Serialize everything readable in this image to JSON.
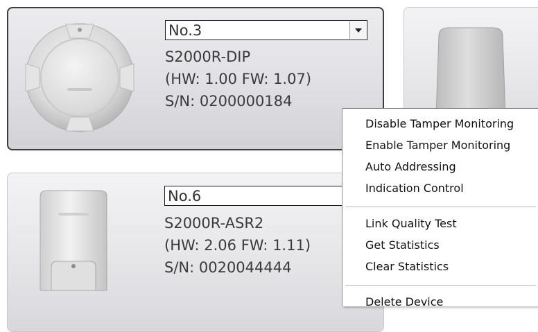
{
  "devices": [
    {
      "address": "No.3",
      "model": "S2000R-DIP",
      "versions": "(HW: 1.00 FW: 1.07)",
      "serial": "S/N: 0200000184",
      "image_icon": "round-smoke-detector-icon",
      "selected": true
    },
    {
      "address": "No.6",
      "model": "S2000R-ASR2",
      "versions": "(HW: 2.06 FW: 1.11)",
      "serial": "S/N: 0020044444",
      "image_icon": "wall-module-icon",
      "selected": false
    },
    {
      "image_icon": "rectangular-sensor-icon",
      "selected": false
    }
  ],
  "dropdown_icon": "chevron-down-icon",
  "context_menu": {
    "groups": [
      [
        "Disable Tamper Monitoring",
        "Enable Tamper Monitoring",
        "Auto Addressing",
        "Indication Control"
      ],
      [
        "Link Quality Test",
        "Get Statistics",
        "Clear Statistics"
      ],
      [
        "Delete Device"
      ]
    ]
  }
}
